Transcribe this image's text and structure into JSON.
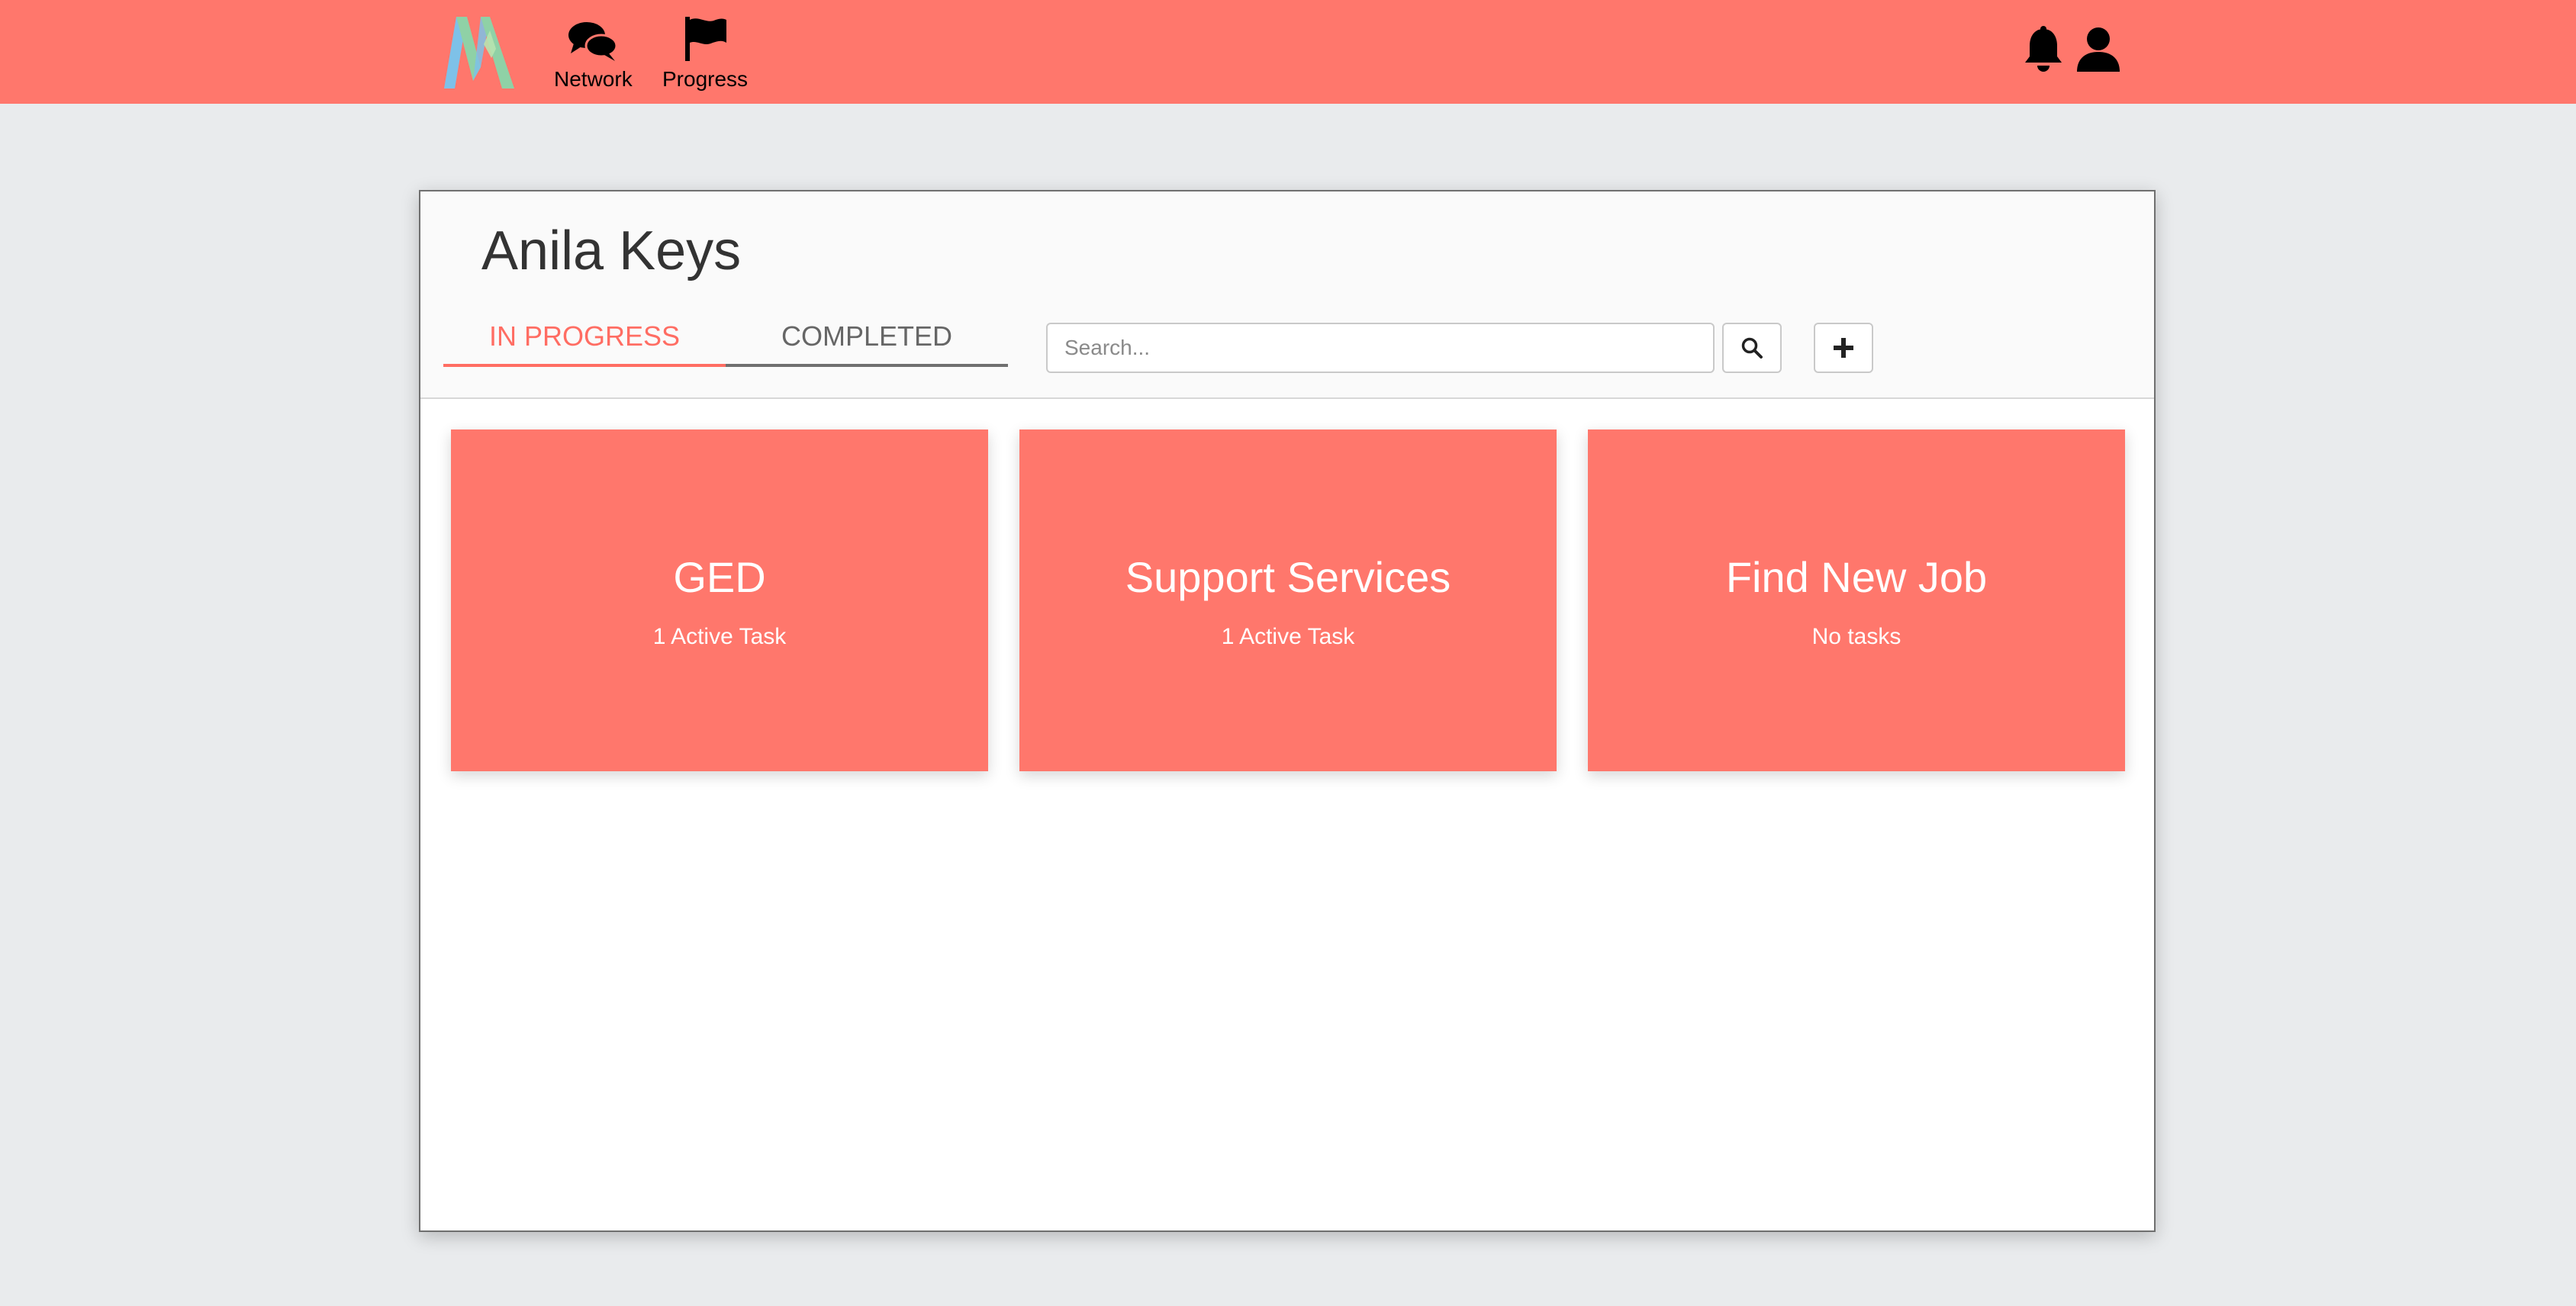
{
  "nav": {
    "logo_icon": "brand-logo",
    "items": [
      {
        "label": "Network",
        "icon": "chat-bubbles-icon"
      },
      {
        "label": "Progress",
        "icon": "flag-icon"
      }
    ],
    "right_icons": [
      "bell-icon",
      "user-icon"
    ]
  },
  "page": {
    "title": "Anila Keys",
    "tabs": [
      {
        "label": "IN PROGRESS",
        "active": true
      },
      {
        "label": "COMPLETED",
        "active": false
      }
    ],
    "search": {
      "placeholder": "Search...",
      "value": ""
    },
    "buttons": {
      "search_icon": "search-icon",
      "add_icon": "plus-icon"
    }
  },
  "goals": [
    {
      "title": "GED",
      "status": "1 Active Task"
    },
    {
      "title": "Support Services",
      "status": "1 Active Task"
    },
    {
      "title": "Find New Job",
      "status": "No tasks"
    }
  ],
  "colors": {
    "accent": "#ff776c",
    "background": "#e9ebed",
    "tab_active": "#ff6d63"
  }
}
